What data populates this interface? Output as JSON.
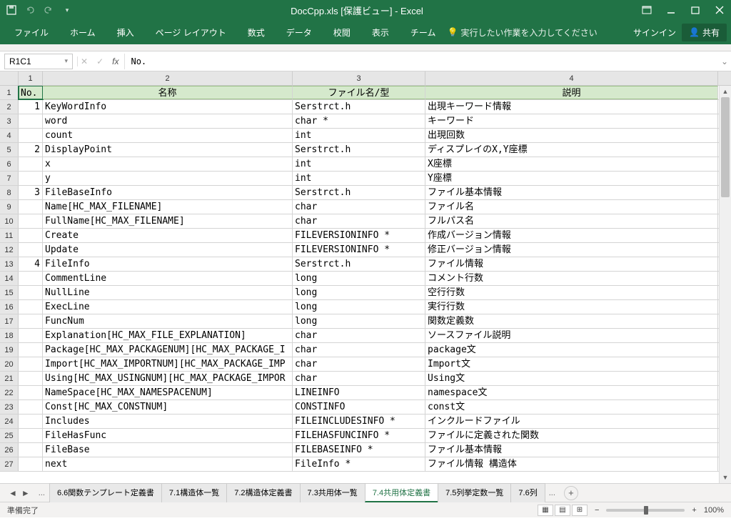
{
  "title": "DocCpp.xls [保護ビュー] - Excel",
  "ribbon": {
    "tabs": [
      "ファイル",
      "ホーム",
      "挿入",
      "ページ レイアウト",
      "数式",
      "データ",
      "校閲",
      "表示",
      "チーム"
    ],
    "tellme": "実行したい作業を入力してください",
    "signin": "サインイン",
    "share": "共有"
  },
  "formula": {
    "namebox": "R1C1",
    "value": "No."
  },
  "columns": [
    "1",
    "2",
    "3",
    "4"
  ],
  "header_row": [
    "No.",
    "名称",
    "ファイル名/型",
    "説明"
  ],
  "rows": [
    {
      "r": 2,
      "no": "1",
      "c2": "KeyWordInfo",
      "c3": "Serstrct.h",
      "c4": "出現キーワード情報"
    },
    {
      "r": 3,
      "no": "",
      "c2": "word",
      "c3": "char *",
      "c4": "キーワード"
    },
    {
      "r": 4,
      "no": "",
      "c2": "count",
      "c3": "int",
      "c4": "出現回数"
    },
    {
      "r": 5,
      "no": "2",
      "c2": "DisplayPoint",
      "c3": "Serstrct.h",
      "c4": "ディスプレイのX,Y座標"
    },
    {
      "r": 6,
      "no": "",
      "c2": "x",
      "c3": "int",
      "c4": "X座標"
    },
    {
      "r": 7,
      "no": "",
      "c2": "y",
      "c3": "int",
      "c4": "Y座標"
    },
    {
      "r": 8,
      "no": "3",
      "c2": "FileBaseInfo",
      "c3": "Serstrct.h",
      "c4": "ファイル基本情報"
    },
    {
      "r": 9,
      "no": "",
      "c2": "Name[HC_MAX_FILENAME]",
      "c3": "char",
      "c4": "ファイル名"
    },
    {
      "r": 10,
      "no": "",
      "c2": "FullName[HC_MAX_FILENAME]",
      "c3": "char",
      "c4": "フルパス名"
    },
    {
      "r": 11,
      "no": "",
      "c2": "Create",
      "c3": "FILEVERSIONINFO *",
      "c4": "作成バージョン情報"
    },
    {
      "r": 12,
      "no": "",
      "c2": "Update",
      "c3": "FILEVERSIONINFO *",
      "c4": "修正バージョン情報"
    },
    {
      "r": 13,
      "no": "4",
      "c2": "FileInfo",
      "c3": "Serstrct.h",
      "c4": "ファイル情報"
    },
    {
      "r": 14,
      "no": "",
      "c2": "CommentLine",
      "c3": "long",
      "c4": "コメント行数"
    },
    {
      "r": 15,
      "no": "",
      "c2": "NullLine",
      "c3": "long",
      "c4": "空行行数"
    },
    {
      "r": 16,
      "no": "",
      "c2": "ExecLine",
      "c3": "long",
      "c4": "実行行数"
    },
    {
      "r": 17,
      "no": "",
      "c2": "FuncNum",
      "c3": "long",
      "c4": "関数定義数"
    },
    {
      "r": 18,
      "no": "",
      "c2": "Explanation[HC_MAX_FILE_EXPLANATION]",
      "c3": "char",
      "c4": "ソースファイル説明"
    },
    {
      "r": 19,
      "no": "",
      "c2": "Package[HC_MAX_PACKAGENUM][HC_MAX_PACKAGE_I",
      "c3": "char",
      "c4": "package文"
    },
    {
      "r": 20,
      "no": "",
      "c2": "Import[HC_MAX_IMPORTNUM][HC_MAX_PACKAGE_IMP",
      "c3": "char",
      "c4": "Import文"
    },
    {
      "r": 21,
      "no": "",
      "c2": "Using[HC_MAX_USINGNUM][HC_MAX_PACKAGE_IMPOR",
      "c3": "char",
      "c4": "Using文"
    },
    {
      "r": 22,
      "no": "",
      "c2": "NameSpace[HC_MAX_NAMESPACENUM]",
      "c3": "LINEINFO",
      "c4": "namespace文"
    },
    {
      "r": 23,
      "no": "",
      "c2": "Const[HC_MAX_CONSTNUM]",
      "c3": "CONSTINFO",
      "c4": "const文"
    },
    {
      "r": 24,
      "no": "",
      "c2": "Includes",
      "c3": "FILEINCLUDESINFO *",
      "c4": "インクルードファイル"
    },
    {
      "r": 25,
      "no": "",
      "c2": "FileHasFunc",
      "c3": "FILEHASFUNCINFO *",
      "c4": "ファイルに定義された関数"
    },
    {
      "r": 26,
      "no": "",
      "c2": "FileBase",
      "c3": "FILEBASEINFO *",
      "c4": "ファイル基本情報"
    },
    {
      "r": 27,
      "no": "",
      "c2": "next",
      "c3": "FileInfo *",
      "c4": "ファイル情報 構造体"
    }
  ],
  "sheets": {
    "tabs": [
      "6.6関数テンプレート定義書",
      "7.1構造体一覧",
      "7.2構造体定義書",
      "7.3共用体一覧",
      "7.4共用体定義書",
      "7.5列挙定数一覧",
      "7.6列"
    ],
    "active": 4
  },
  "status": {
    "left": "準備完了",
    "zoom": "100%"
  }
}
